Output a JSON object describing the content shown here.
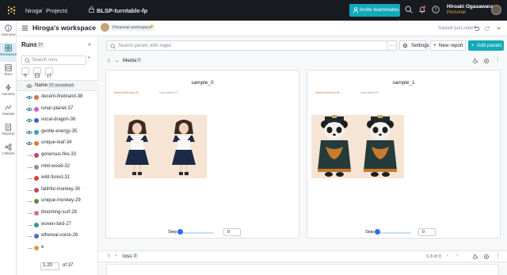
{
  "topbar": {
    "breadcrumbs": [
      "hiroga",
      "Projects",
      "BLSP-turntable-fp"
    ],
    "invite_label": "Invite teammates",
    "user_name": "Hiroaki Ogasawara",
    "user_plan": "Personal"
  },
  "nav": [
    {
      "label": "Overview",
      "icon": "info-icon"
    },
    {
      "label": "Workspace",
      "icon": "workspace-icon",
      "active": true
    },
    {
      "label": "Runs",
      "icon": "runs-icon"
    },
    {
      "label": "Automat.",
      "icon": "automation-icon"
    },
    {
      "label": "Sweeps",
      "icon": "sweeps-icon"
    },
    {
      "label": "Reports",
      "icon": "reports-icon"
    },
    {
      "label": "Artifacts",
      "icon": "artifacts-icon"
    }
  ],
  "header": {
    "title": "Hiroga's workspace",
    "workspace_badge": "Personal workspace",
    "saved": "Saved just now"
  },
  "runs": {
    "title": "Runs",
    "count": "37",
    "search_placeholder": "Search runs",
    "regex": "*",
    "col_name": "Name",
    "visualized": "22 visualized",
    "items": [
      {
        "name": "decent-firebrand-38",
        "color": "#e0703c",
        "visible": true
      },
      {
        "name": "lunar-planet-37",
        "color": "#c95fcf",
        "visible": true
      },
      {
        "name": "vocal-dragon-36",
        "color": "#3f5fd1",
        "visible": true
      },
      {
        "name": "gentle-energy-35",
        "color": "#2fa8b0",
        "visible": true
      },
      {
        "name": "unique-leaf-34",
        "color": "#e07c2e",
        "visible": true
      },
      {
        "name": "generous-fire-33",
        "color": "#c2426b",
        "visible": false
      },
      {
        "name": "mild-wood-32",
        "color": "#8a8e95",
        "visible": false
      },
      {
        "name": "wild-forest-31",
        "color": "#d2452f",
        "visible": false
      },
      {
        "name": "faithful-monkey-30",
        "color": "#b9475f",
        "visible": false
      },
      {
        "name": "unique-monkey-29",
        "color": "#5a8a3c",
        "visible": false
      },
      {
        "name": "blooming-surf-28",
        "color": "#d96aa0",
        "visible": false
      },
      {
        "name": "woven-bird-27",
        "color": "#2e9c8a",
        "visible": false
      },
      {
        "name": "ethereal-voice-26",
        "color": "#4b6fc4",
        "visible": false
      },
      {
        "name": "e",
        "color": "#e09a3e",
        "visible": false
      }
    ],
    "pager_sel": "1-20",
    "pager_of": "of 37"
  },
  "toolbar": {
    "search_placeholder": "Search panels with regex",
    "more": "···",
    "settings": "Settings",
    "new_report": "New report",
    "add_panels": "Add panels"
  },
  "media_section": {
    "title": "Media",
    "count": "2"
  },
  "panels": [
    {
      "title": "sample_0",
      "cap_left": "decent-firebrand-38",
      "cap_right": "lunar-planet-37",
      "step_label": "Step",
      "step_value": "0",
      "kind": "girls"
    },
    {
      "title": "sample_1",
      "cap_left": "decent-firebrand-38",
      "cap_right": "lunar-planet-37",
      "step_label": "Step",
      "step_value": "0",
      "kind": "pandas"
    }
  ],
  "loss_section": {
    "title": "loss",
    "count": "3",
    "range": "1-3 of 3"
  },
  "colors": {
    "accent": "#13a9ba",
    "topbar": "#171a1f",
    "slider": "#2d6df0"
  }
}
